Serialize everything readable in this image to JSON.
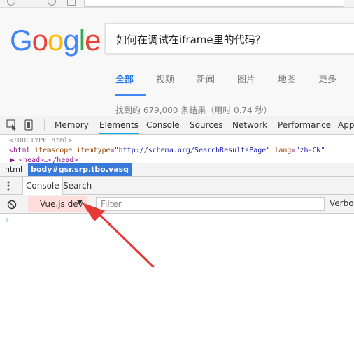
{
  "google": {
    "logo_letters": [
      {
        "ch": "G",
        "color": "#4285F4"
      },
      {
        "ch": "o",
        "color": "#EA4335"
      },
      {
        "ch": "o",
        "color": "#FBBC05"
      },
      {
        "ch": "g",
        "color": "#4285F4"
      },
      {
        "ch": "l",
        "color": "#34A853"
      },
      {
        "ch": "e",
        "color": "#EA4335"
      }
    ],
    "query": "如何在调试在iframe里的代码？",
    "tabs": [
      "全部",
      "视频",
      "新闻",
      "图片",
      "地图",
      "更多"
    ],
    "active_tab": "全部",
    "stats": "找到约 679,000 条结果（用时 0.74 秒）"
  },
  "devtools": {
    "tabs": [
      "Memory",
      "Elements",
      "Console",
      "Sources",
      "Network",
      "Performance",
      "App"
    ],
    "active_tab": "Elements",
    "elements_lines": {
      "doctype": "<!DOCTYPE html>",
      "html_tag": "<html ",
      "attr1": "itemscope ",
      "attr2": "itemtype",
      "eq1": "=",
      "val2": "\"http://schema.org/SearchResultsPage\"",
      "attr3": " lang",
      "eq2": "=",
      "val3": "\"zh-CN\"",
      "head": "▶ <head>…</head>"
    },
    "breadcrumb": [
      "html",
      "body#gsr.srp.tbo.vasq"
    ],
    "drawer_tabs": [
      "Console",
      "Search"
    ],
    "active_drawer_tab": "Console",
    "console": {
      "context": "Vue.js dev",
      "context_arrow": "▼",
      "filter_placeholder": "Filter",
      "level": "Verbos",
      "prompt": "›"
    }
  },
  "annotation": {
    "arrow_color": "#E53935"
  }
}
